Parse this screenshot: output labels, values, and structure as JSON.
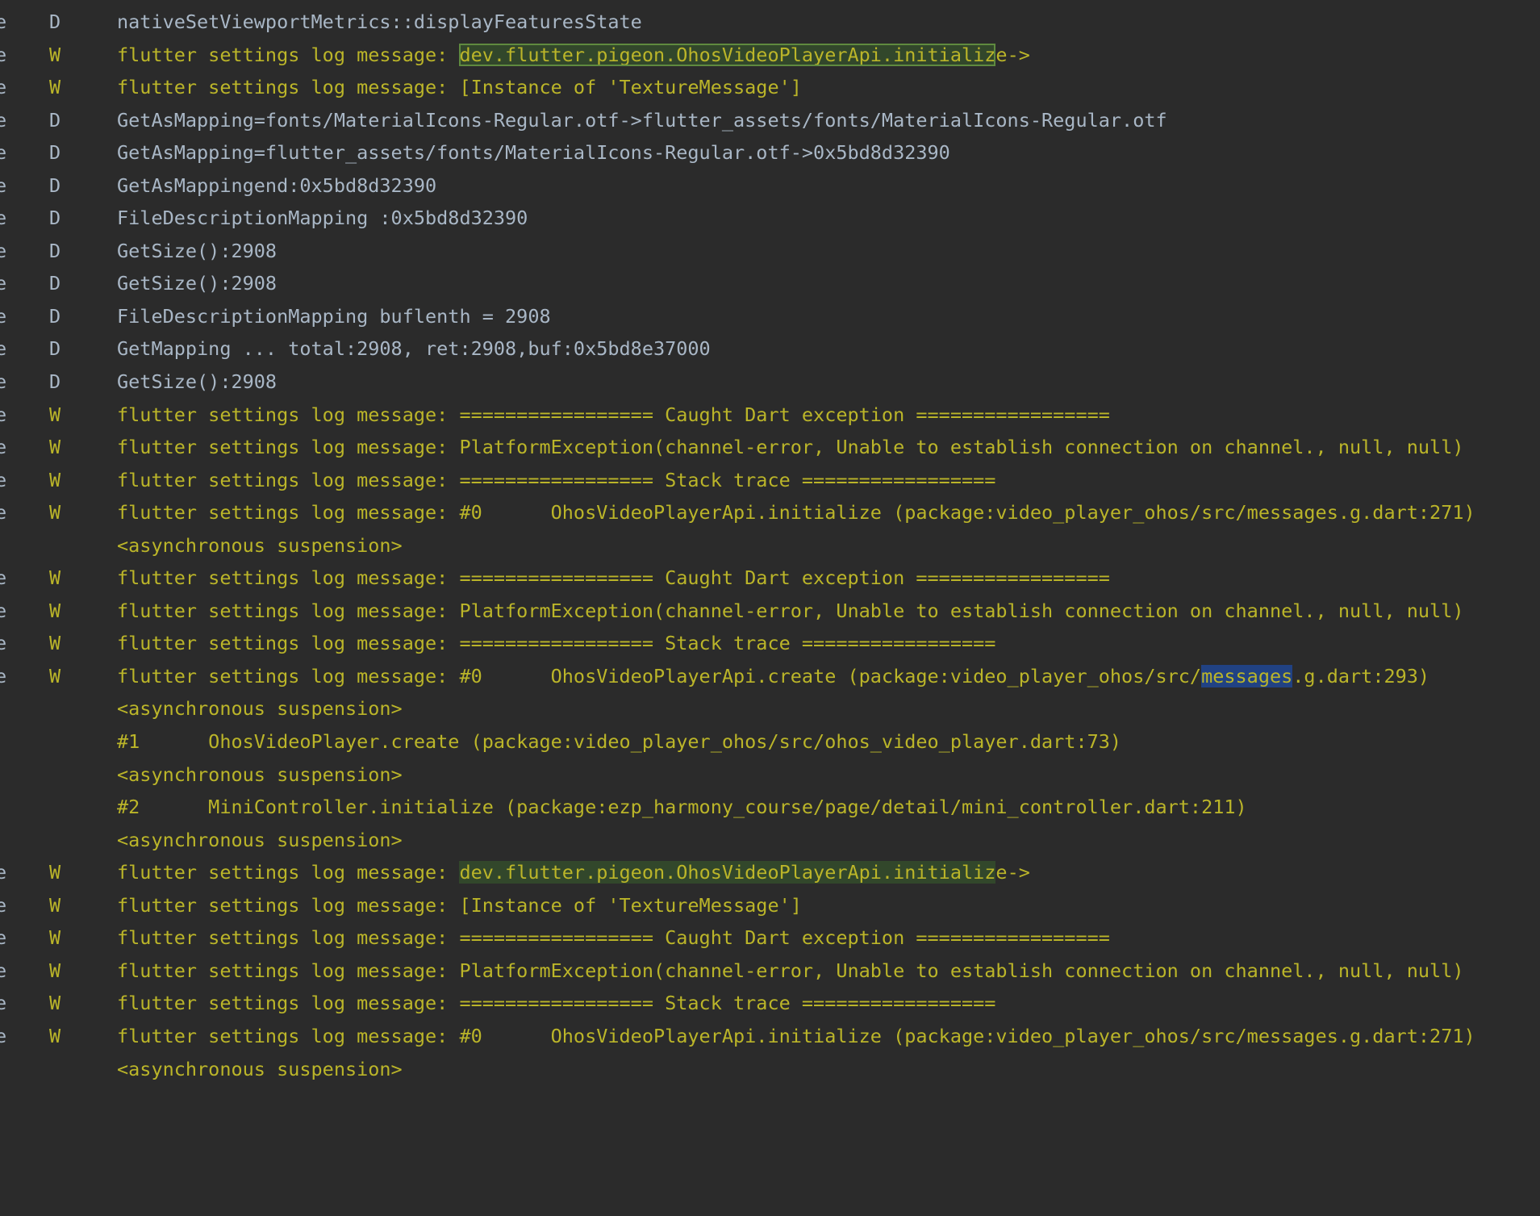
{
  "colors": {
    "background": "#2b2b2b",
    "debug_text": "#a9b7c6",
    "warn_text": "#bbb529",
    "search_match_bg": "#32472b",
    "selection_bg": "#214283"
  },
  "log": {
    "rows": [
      {
        "edge": "e",
        "level": "D",
        "pre": "nativeSetViewportMetrics::displayFeaturesState",
        "hl": "",
        "post": "",
        "hlType": ""
      },
      {
        "edge": "e",
        "level": "W",
        "pre": "flutter settings log message: ",
        "hl": "dev.flutter.pigeon.OhosVideoPlayerApi.initializ",
        "post": "e->",
        "hlType": "green-boxed"
      },
      {
        "edge": "e",
        "level": "W",
        "pre": "flutter settings log message: [Instance of 'TextureMessage']",
        "hl": "",
        "post": "",
        "hlType": ""
      },
      {
        "edge": "e",
        "level": "D",
        "pre": "GetAsMapping=fonts/MaterialIcons-Regular.otf->flutter_assets/fonts/MaterialIcons-Regular.otf",
        "hl": "",
        "post": "",
        "hlType": ""
      },
      {
        "edge": "e",
        "level": "D",
        "pre": "GetAsMapping=flutter_assets/fonts/MaterialIcons-Regular.otf->0x5bd8d32390",
        "hl": "",
        "post": "",
        "hlType": ""
      },
      {
        "edge": "e",
        "level": "D",
        "pre": "GetAsMappingend:0x5bd8d32390",
        "hl": "",
        "post": "",
        "hlType": ""
      },
      {
        "edge": "e",
        "level": "D",
        "pre": "FileDescriptionMapping :0x5bd8d32390",
        "hl": "",
        "post": "",
        "hlType": ""
      },
      {
        "edge": "e",
        "level": "D",
        "pre": "GetSize():2908",
        "hl": "",
        "post": "",
        "hlType": ""
      },
      {
        "edge": "e",
        "level": "D",
        "pre": "GetSize():2908",
        "hl": "",
        "post": "",
        "hlType": ""
      },
      {
        "edge": "e",
        "level": "D",
        "pre": "FileDescriptionMapping buflenth = 2908",
        "hl": "",
        "post": "",
        "hlType": ""
      },
      {
        "edge": "e",
        "level": "D",
        "pre": "GetMapping ... total:2908, ret:2908,buf:0x5bd8e37000",
        "hl": "",
        "post": "",
        "hlType": ""
      },
      {
        "edge": "e",
        "level": "D",
        "pre": "GetSize():2908",
        "hl": "",
        "post": "",
        "hlType": ""
      },
      {
        "edge": "e",
        "level": "W",
        "pre": "flutter settings log message: ================= Caught Dart exception =================",
        "hl": "",
        "post": "",
        "hlType": ""
      },
      {
        "edge": "e",
        "level": "W",
        "pre": "flutter settings log message: PlatformException(channel-error, Unable to establish connection on channel., null, null)",
        "hl": "",
        "post": "",
        "hlType": ""
      },
      {
        "edge": "e",
        "level": "W",
        "pre": "flutter settings log message: ================= Stack trace =================",
        "hl": "",
        "post": "",
        "hlType": ""
      },
      {
        "edge": "e",
        "level": "W",
        "pre": "flutter settings log message: #0      OhosVideoPlayerApi.initialize (package:video_player_ohos/src/messages.g.dart:271)",
        "hl": "",
        "post": "",
        "hlType": ""
      },
      {
        "edge": "",
        "level": "",
        "pre": "<asynchronous suspension>",
        "hl": "",
        "post": "",
        "hlType": ""
      },
      {
        "edge": "e",
        "level": "W",
        "pre": "flutter settings log message: ================= Caught Dart exception =================",
        "hl": "",
        "post": "",
        "hlType": ""
      },
      {
        "edge": "e",
        "level": "W",
        "pre": "flutter settings log message: PlatformException(channel-error, Unable to establish connection on channel., null, null)",
        "hl": "",
        "post": "",
        "hlType": ""
      },
      {
        "edge": "e",
        "level": "W",
        "pre": "flutter settings log message: ================= Stack trace =================",
        "hl": "",
        "post": "",
        "hlType": ""
      },
      {
        "edge": "e",
        "level": "W",
        "pre": "flutter settings log message: #0      OhosVideoPlayerApi.create (package:video_player_ohos/src/",
        "hl": "messages",
        "post": ".g.dart:293)",
        "hlType": "blue"
      },
      {
        "edge": "",
        "level": "",
        "pre": "<asynchronous suspension>",
        "hl": "",
        "post": "",
        "hlType": ""
      },
      {
        "edge": "",
        "level": "",
        "pre": "#1      OhosVideoPlayer.create (package:video_player_ohos/src/ohos_video_player.dart:73)",
        "hl": "",
        "post": "",
        "hlType": ""
      },
      {
        "edge": "",
        "level": "",
        "pre": "<asynchronous suspension>",
        "hl": "",
        "post": "",
        "hlType": ""
      },
      {
        "edge": "",
        "level": "",
        "pre": "#2      MiniController.initialize (package:ezp_harmony_course/page/detail/mini_controller.dart:211)",
        "hl": "",
        "post": "",
        "hlType": ""
      },
      {
        "edge": "",
        "level": "",
        "pre": "<asynchronous suspension>",
        "hl": "",
        "post": "",
        "hlType": ""
      },
      {
        "edge": "e",
        "level": "W",
        "pre": "flutter settings log message: ",
        "hl": "dev.flutter.pigeon.OhosVideoPlayerApi.initializ",
        "post": "e->",
        "hlType": "green"
      },
      {
        "edge": "e",
        "level": "W",
        "pre": "flutter settings log message: [Instance of 'TextureMessage']",
        "hl": "",
        "post": "",
        "hlType": ""
      },
      {
        "edge": "e",
        "level": "W",
        "pre": "flutter settings log message: ================= Caught Dart exception =================",
        "hl": "",
        "post": "",
        "hlType": ""
      },
      {
        "edge": "e",
        "level": "W",
        "pre": "flutter settings log message: PlatformException(channel-error, Unable to establish connection on channel., null, null)",
        "hl": "",
        "post": "",
        "hlType": ""
      },
      {
        "edge": "e",
        "level": "W",
        "pre": "flutter settings log message: ================= Stack trace =================",
        "hl": "",
        "post": "",
        "hlType": ""
      },
      {
        "edge": "e",
        "level": "W",
        "pre": "flutter settings log message: #0      OhosVideoPlayerApi.initialize (package:video_player_ohos/src/messages.g.dart:271)",
        "hl": "",
        "post": "",
        "hlType": ""
      },
      {
        "edge": "",
        "level": "",
        "pre": "<asynchronous suspension>",
        "hl": "",
        "post": "",
        "hlType": ""
      }
    ]
  }
}
